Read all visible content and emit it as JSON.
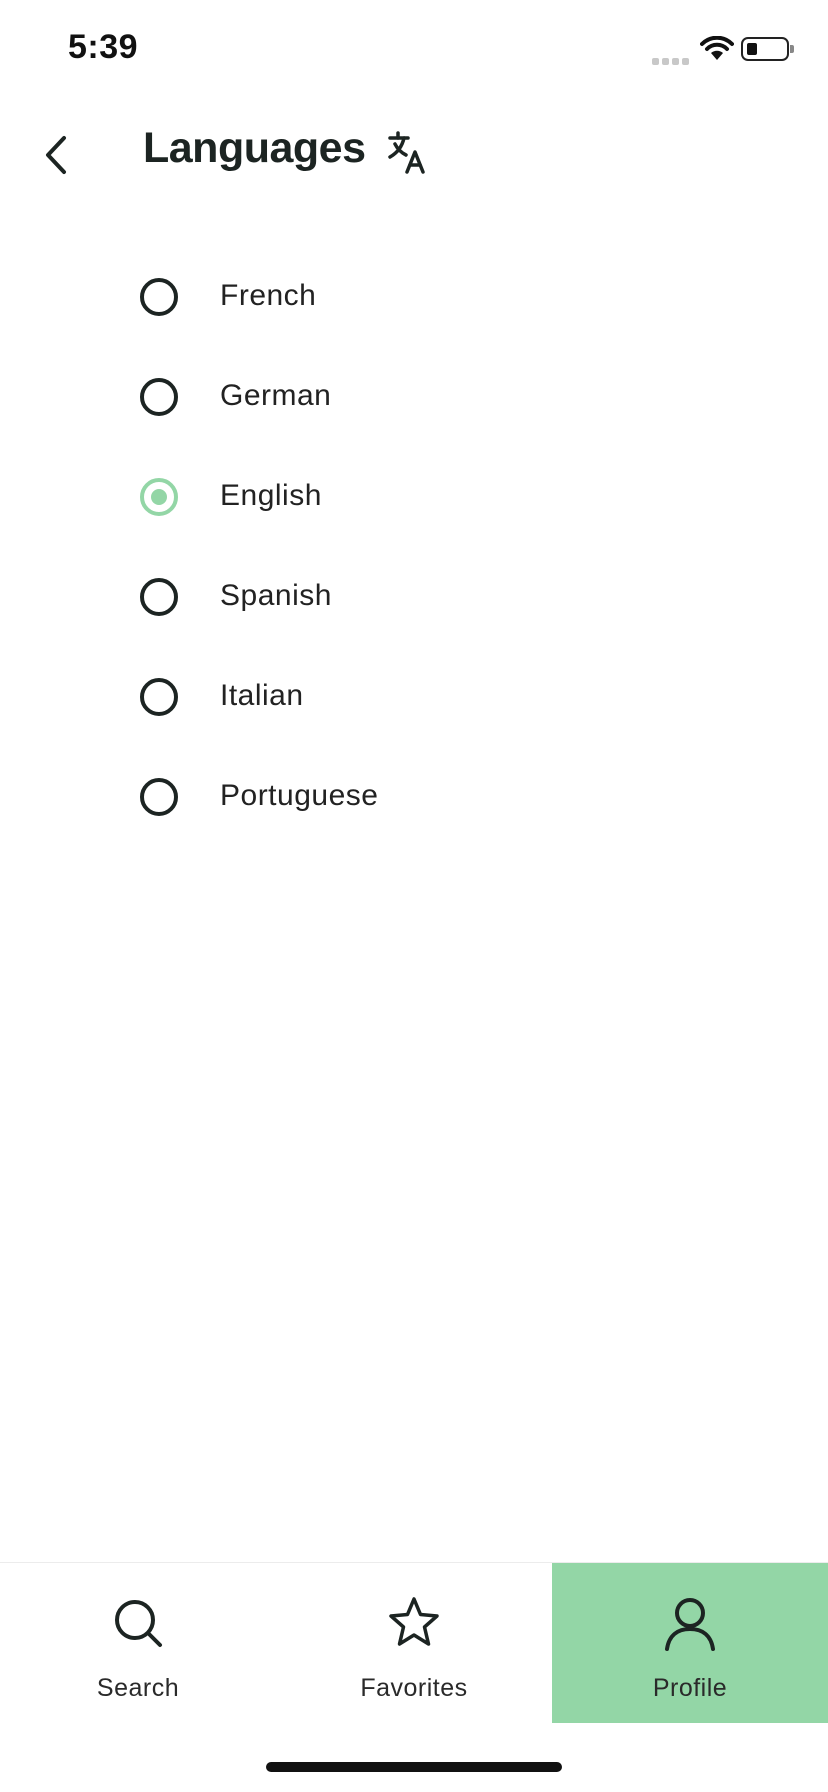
{
  "status_bar": {
    "time": "5:39"
  },
  "header": {
    "title": "Languages"
  },
  "languages": [
    {
      "label": "French",
      "selected": false
    },
    {
      "label": "German",
      "selected": false
    },
    {
      "label": "English",
      "selected": true
    },
    {
      "label": "Spanish",
      "selected": false
    },
    {
      "label": "Italian",
      "selected": false
    },
    {
      "label": "Portuguese",
      "selected": false
    }
  ],
  "tabs": [
    {
      "label": "Search",
      "icon": "search-icon",
      "active": false
    },
    {
      "label": "Favorites",
      "icon": "star-icon",
      "active": false
    },
    {
      "label": "Profile",
      "icon": "user-icon",
      "active": true
    }
  ],
  "colors": {
    "accent": "#93d6a6",
    "text": "#1c2422"
  }
}
